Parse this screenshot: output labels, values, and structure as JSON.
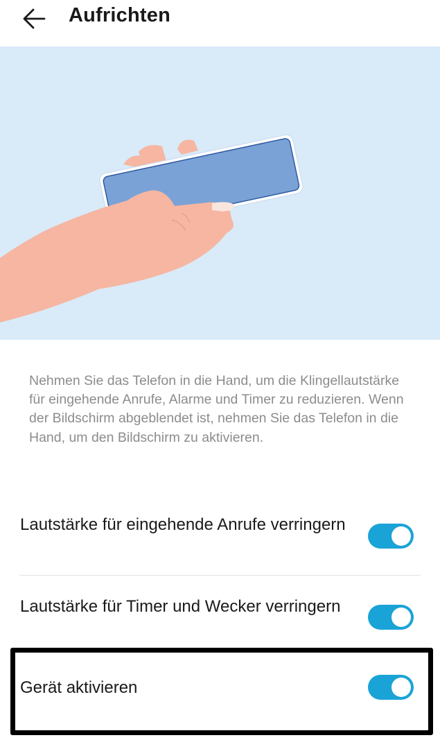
{
  "header": {
    "title": "Aufrichten",
    "back_icon": "arrow-left-icon"
  },
  "illustration": {
    "icon": "hand-holding-phone-illustration",
    "colors": {
      "background": "#d9eaf8",
      "skin": "#f6b6a1",
      "phone_screen": "#7aa2d6",
      "phone_frame": "#ffffff"
    }
  },
  "description": "Nehmen Sie das Telefon in die Hand, um die Klingellautstärke für eingehende Anrufe, Alarme und Timer zu reduzieren. Wenn der Bildschirm abgeblendet ist, nehmen Sie das Telefon in die Hand, um den Bildschirm zu aktivieren.",
  "settings": [
    {
      "label": "Lautstärke für eingehende Anrufe verringern",
      "enabled": true
    },
    {
      "label": "Lautstärke für Timer und Wecker verringern",
      "enabled": true
    },
    {
      "label": "Gerät aktivieren",
      "enabled": true
    }
  ],
  "colors": {
    "toggle_on": "#1aa3d6",
    "highlight_border": "#000000"
  }
}
